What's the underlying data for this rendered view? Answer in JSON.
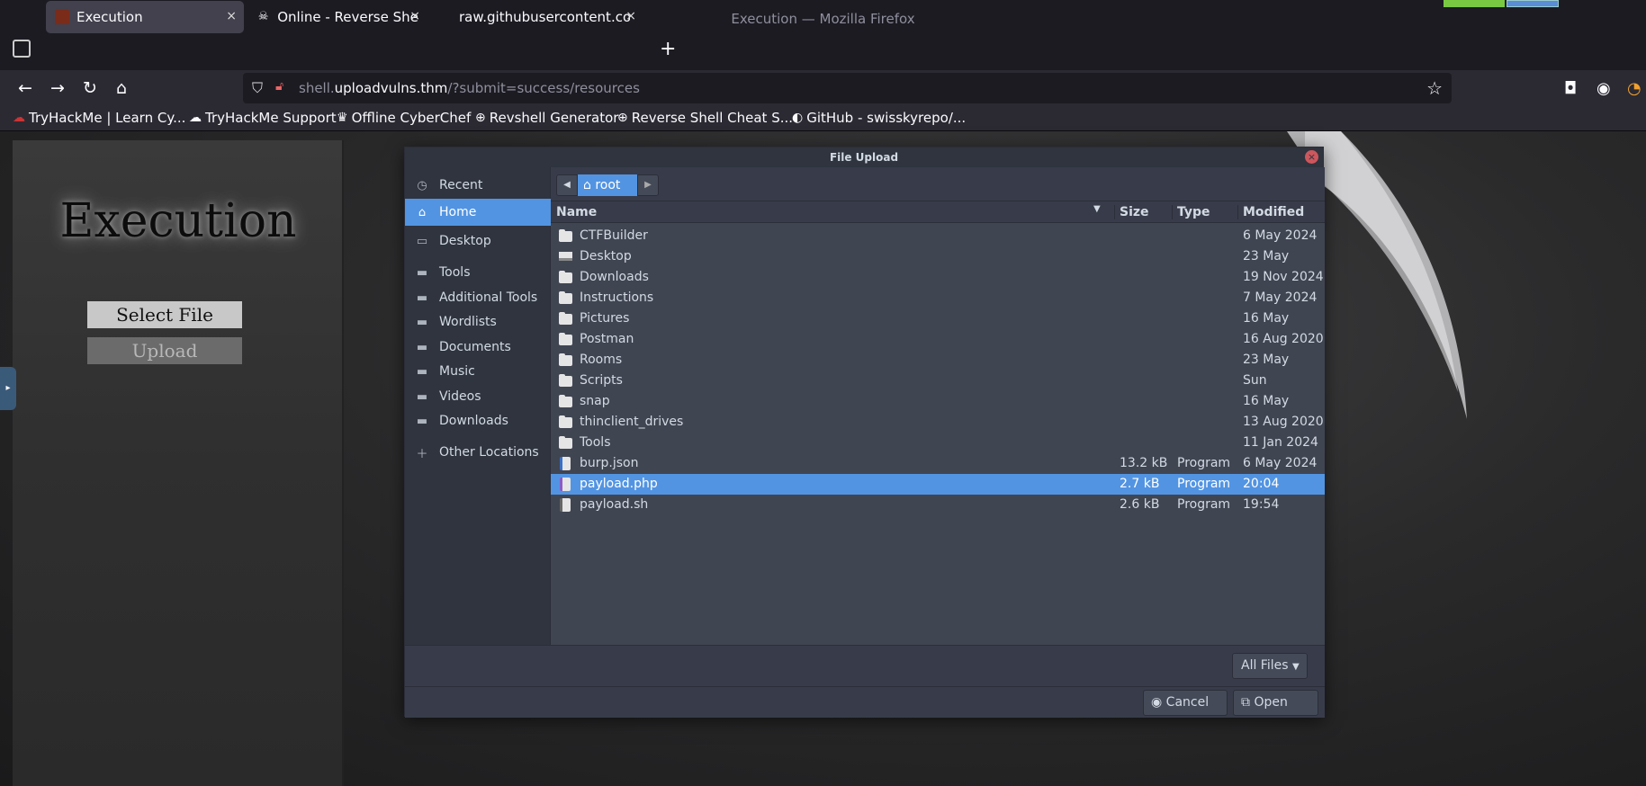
{
  "window": {
    "title": "Execution — Mozilla Firefox"
  },
  "tabs": [
    {
      "label": "Execution",
      "close": "×"
    },
    {
      "label": "Online - Reverse Shell Ge",
      "close": "×"
    },
    {
      "label": "raw.githubusercontent.com/",
      "close": "×"
    }
  ],
  "new_tab": "+",
  "urlbar": {
    "host_prefix": "shell.",
    "host": "uploadvulns.thm",
    "path": "/?submit=success/resources"
  },
  "bookmarks": [
    "TryHackMe | Learn Cy...",
    "TryHackMe Support",
    "Offline CyberChef",
    "Revshell Generator",
    "Reverse Shell Cheat S...",
    "GitHub - swisskyrepo/..."
  ],
  "page": {
    "title": "Execution",
    "select_file": "Select File",
    "upload": "Upload"
  },
  "dialog": {
    "title": "File Upload",
    "places": [
      {
        "label": "Recent",
        "icon": "clock-icon"
      },
      {
        "label": "Home",
        "icon": "home-icon"
      },
      {
        "label": "Desktop",
        "icon": "desktop-icon"
      },
      {
        "label": "Tools",
        "icon": "folder-icon"
      },
      {
        "label": "Additional Tools",
        "icon": "folder-icon"
      },
      {
        "label": "Wordlists",
        "icon": "folder-icon"
      },
      {
        "label": "Documents",
        "icon": "folder-icon"
      },
      {
        "label": "Music",
        "icon": "folder-icon"
      },
      {
        "label": "Videos",
        "icon": "folder-icon"
      },
      {
        "label": "Downloads",
        "icon": "folder-icon"
      },
      {
        "label": "Other Locations",
        "icon": "plus-icon"
      }
    ],
    "path": {
      "current": "root"
    },
    "columns": {
      "name": "Name",
      "size": "Size",
      "type": "Type",
      "modified": "Modified"
    },
    "files": [
      {
        "name": "CTFBuilder",
        "size": "",
        "type": "",
        "modified": "6 May 2024",
        "kind": "folder"
      },
      {
        "name": "Desktop",
        "size": "",
        "type": "",
        "modified": "23 May",
        "kind": "desktop"
      },
      {
        "name": "Downloads",
        "size": "",
        "type": "",
        "modified": "19 Nov 2024",
        "kind": "folder"
      },
      {
        "name": "Instructions",
        "size": "",
        "type": "",
        "modified": "7 May 2024",
        "kind": "folder"
      },
      {
        "name": "Pictures",
        "size": "",
        "type": "",
        "modified": "16 May",
        "kind": "folder"
      },
      {
        "name": "Postman",
        "size": "",
        "type": "",
        "modified": "16 Aug 2020",
        "kind": "folder"
      },
      {
        "name": "Rooms",
        "size": "",
        "type": "",
        "modified": "23 May",
        "kind": "folder"
      },
      {
        "name": "Scripts",
        "size": "",
        "type": "",
        "modified": "Sun",
        "kind": "folder"
      },
      {
        "name": "snap",
        "size": "",
        "type": "",
        "modified": "16 May",
        "kind": "folder"
      },
      {
        "name": "thinclient_drives",
        "size": "",
        "type": "",
        "modified": "13 Aug 2020",
        "kind": "folder"
      },
      {
        "name": "Tools",
        "size": "",
        "type": "",
        "modified": "11 Jan 2024",
        "kind": "folder"
      },
      {
        "name": "burp.json",
        "size": "13.2 kB",
        "type": "Program",
        "modified": "6 May 2024",
        "kind": "json"
      },
      {
        "name": "payload.php",
        "size": "2.7 kB",
        "type": "Program",
        "modified": "20:04",
        "kind": "php"
      },
      {
        "name": "payload.sh",
        "size": "2.6 kB",
        "type": "Program",
        "modified": "19:54",
        "kind": "sh"
      }
    ],
    "selected_file": "payload.php",
    "filter": "All Files",
    "cancel": "Cancel",
    "open": "Open"
  },
  "colors": {
    "accent": "#5294e2",
    "dialog_bg": "#383c4a",
    "list_bg": "#404552"
  }
}
